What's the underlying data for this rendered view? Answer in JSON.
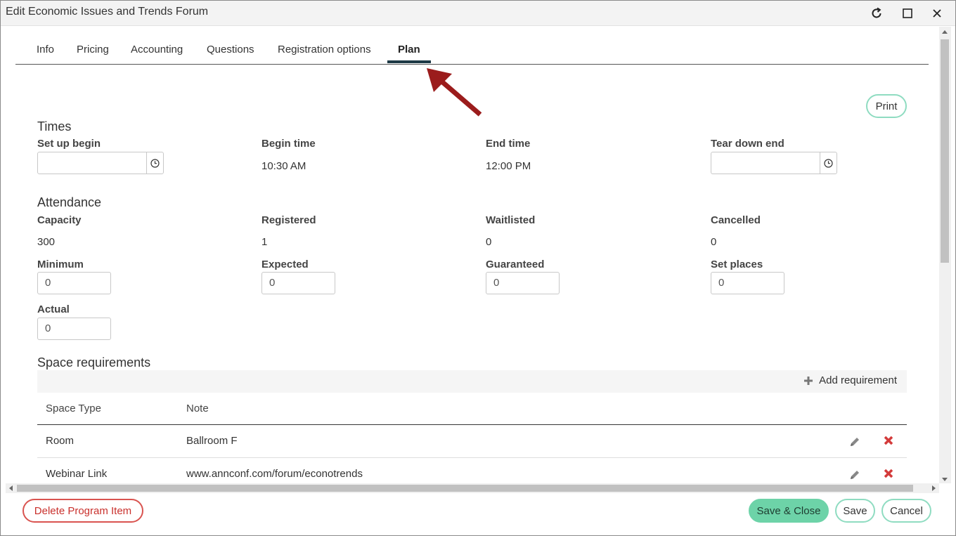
{
  "window": {
    "title": "Edit Economic Issues and Trends Forum"
  },
  "tabs": [
    {
      "label": "Info"
    },
    {
      "label": "Pricing"
    },
    {
      "label": "Accounting"
    },
    {
      "label": "Questions"
    },
    {
      "label": "Registration options"
    },
    {
      "label": "Plan",
      "active": true
    }
  ],
  "print_label": "Print",
  "times": {
    "heading": "Times",
    "setup_begin_label": "Set up begin",
    "setup_begin_value": "",
    "begin_time_label": "Begin time",
    "begin_time_value": "10:30 AM",
    "end_time_label": "End time",
    "end_time_value": "12:00 PM",
    "teardown_end_label": "Tear down end",
    "teardown_end_value": ""
  },
  "attendance": {
    "heading": "Attendance",
    "capacity_label": "Capacity",
    "capacity_value": "300",
    "registered_label": "Registered",
    "registered_value": "1",
    "waitlisted_label": "Waitlisted",
    "waitlisted_value": "0",
    "cancelled_label": "Cancelled",
    "cancelled_value": "0",
    "minimum_label": "Minimum",
    "minimum_value": "0",
    "expected_label": "Expected",
    "expected_value": "0",
    "guaranteed_label": "Guaranteed",
    "guaranteed_value": "0",
    "set_places_label": "Set places",
    "set_places_value": "0",
    "actual_label": "Actual",
    "actual_value": "0"
  },
  "space": {
    "heading": "Space requirements",
    "add_label": "Add requirement",
    "columns": [
      "Space Type",
      "Note"
    ],
    "rows": [
      {
        "type": "Room",
        "note": "Ballroom F"
      },
      {
        "type": "Webinar Link",
        "note": "www.annconf.com/forum/econotrends"
      }
    ]
  },
  "footer": {
    "delete_label": "Delete Program Item",
    "save_close_label": "Save & Close",
    "save_label": "Save",
    "cancel_label": "Cancel"
  },
  "colors": {
    "accent_green": "#6dd3a8",
    "outline_green": "#8fdcc1",
    "danger_red": "#d9534f",
    "tab_underline": "#1e3a46",
    "arrow": "#9b1c1c"
  },
  "icons": [
    "refresh-icon",
    "maximize-icon",
    "close-icon",
    "clock-icon",
    "plus-icon",
    "pencil-icon",
    "delete-x-icon"
  ]
}
